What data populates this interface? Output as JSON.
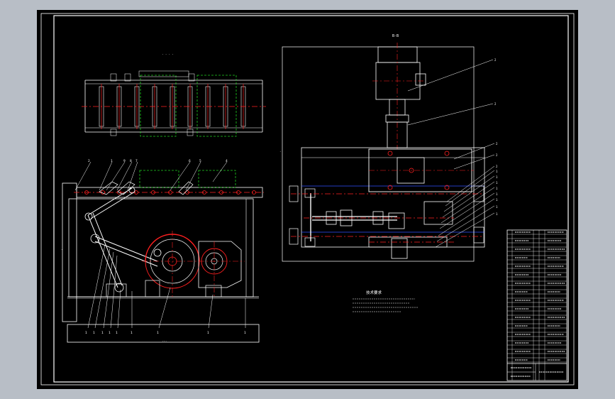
{
  "colors": {
    "canvas_bg": "#b8bec6",
    "sheet_bg": "#000000",
    "line_white": "#ffffff",
    "line_red": "#ff2020",
    "line_green": "#20d020",
    "line_blue": "#3050ff",
    "line_magenta": "#ff40ff",
    "line_yellow": "#ffff40"
  },
  "drawing": {
    "section_label": "B-B",
    "technical_requirements_title": "技术要求"
  }
}
